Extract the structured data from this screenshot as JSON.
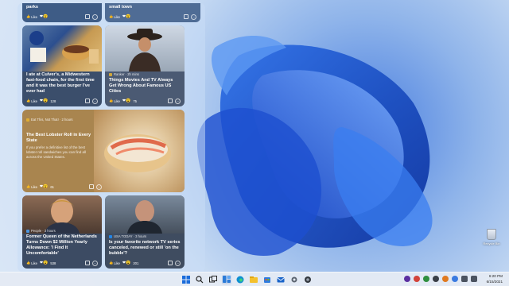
{
  "widgets": {
    "cards": [
      {
        "title": "America's deadliest national parks",
        "likes_label": "Like",
        "reaction_count": ""
      },
      {
        "title": "small town",
        "likes_label": "Like",
        "reaction_count": ""
      },
      {
        "source": "",
        "title": "I ate at Culver's, a Midwestern fast-food chain, for the first time and it was the best burger I've ever had",
        "likes_label": "Like",
        "reaction_count": "128"
      },
      {
        "source": "Ranker · 2h mins",
        "title": "Things Movies And TV Always Get Wrong About Famous US Cities",
        "likes_label": "Like",
        "reaction_count": "75"
      },
      {
        "source": "Eat This, Not That! · 2 hours",
        "title": "The Best Lobster Roll in Every State",
        "desc": "If you prefer a definitive list of the best lobster roll sandwiches you can find all across the United States.",
        "likes_label": "Like",
        "reaction_count": "61"
      },
      {
        "source": "People · 3 hours",
        "title": "Former Queen of the Netherlands Turns Down $2 Million Yearly Allowance: 'I Find It Uncomfortable'",
        "likes_label": "Like",
        "reaction_count": "538"
      },
      {
        "source": "USA TODAY · 3 hours",
        "title": "Is your favorite network TV series canceled, renewed or still 'on the bubble'?",
        "likes_label": "Like",
        "reaction_count": "201"
      }
    ]
  },
  "desktop": {
    "recycle_bin_label": "Recycle Bin"
  },
  "taskbar": {
    "time": "6:20 PM",
    "date": "6/15/2021",
    "icons": [
      "windows-start",
      "search",
      "task-view",
      "widgets",
      "edge",
      "file-explorer",
      "store",
      "mail",
      "settings",
      "other-app"
    ]
  },
  "colors": {
    "accent": "#1a56d6",
    "taskbar_bg": "#e4eaf4"
  }
}
